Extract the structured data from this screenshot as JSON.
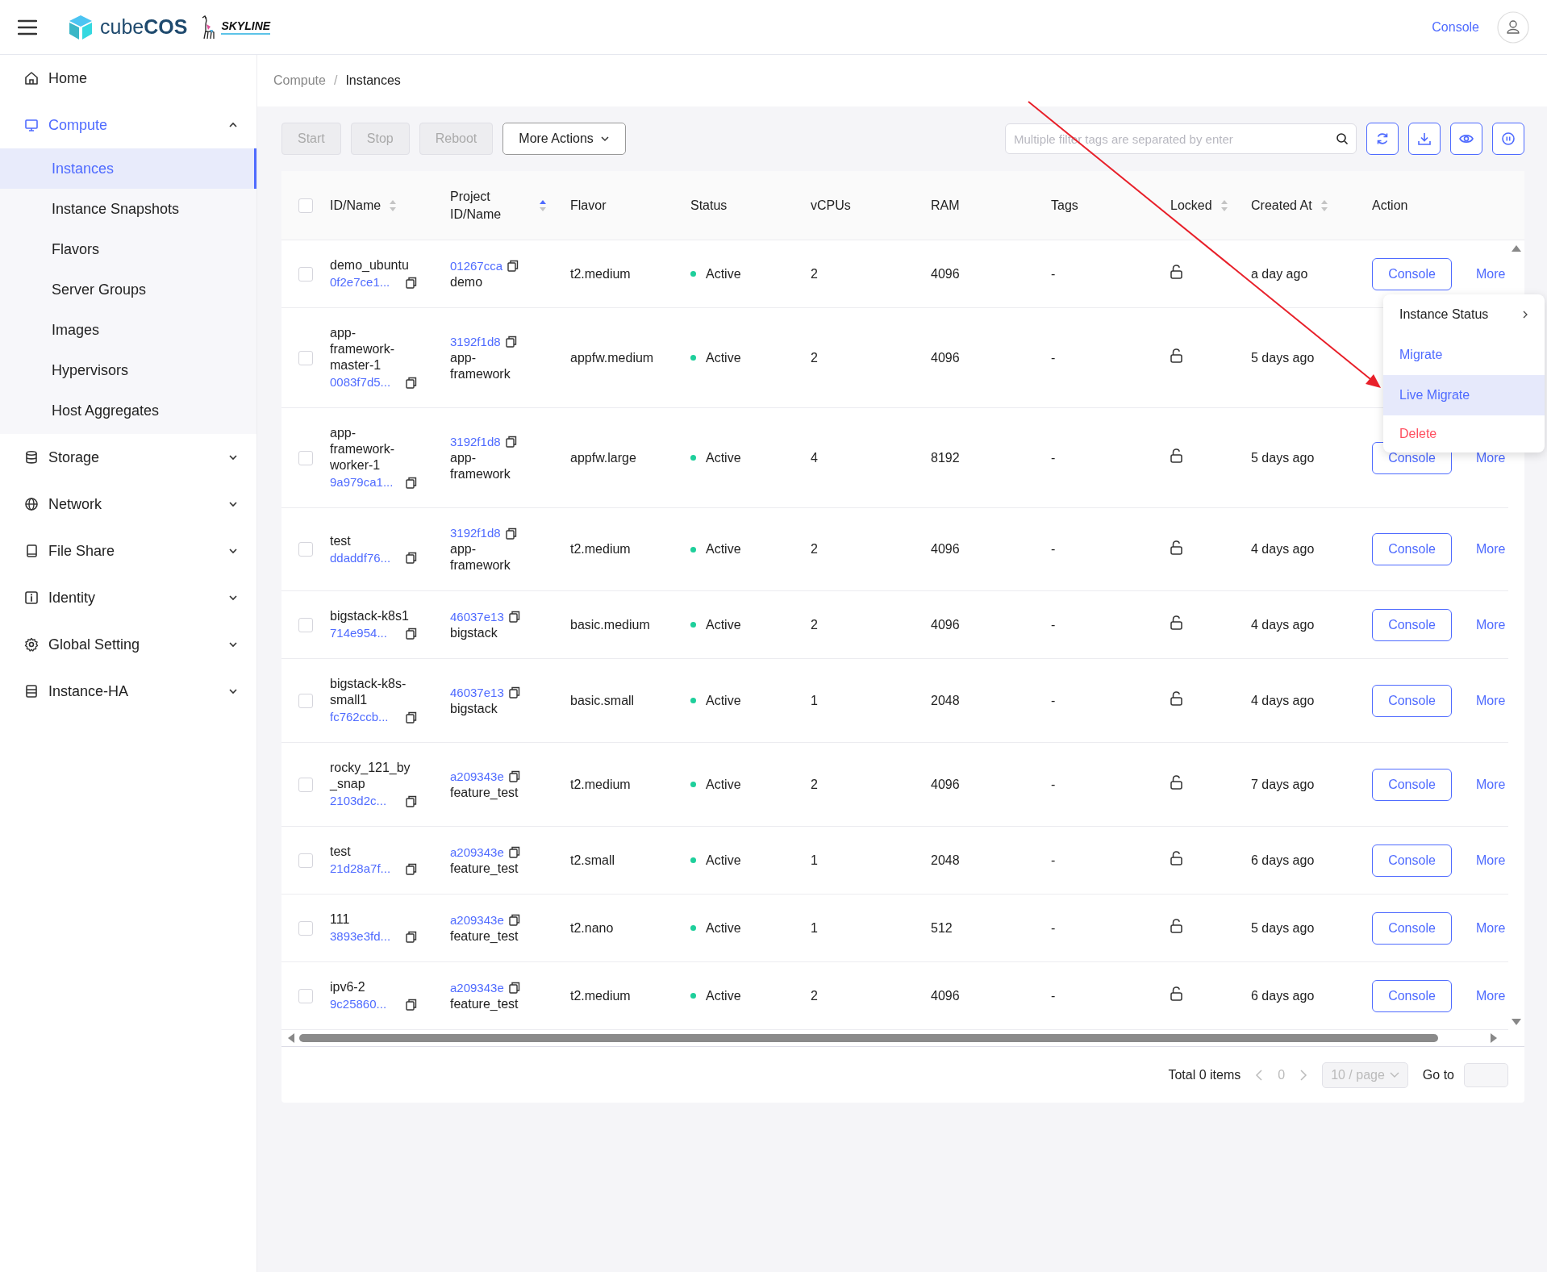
{
  "header": {
    "brand": "cube**COS**",
    "partner": "SKYLINE",
    "console_link": "Console"
  },
  "sidebar": {
    "items": [
      {
        "label": "Home"
      },
      {
        "label": "Compute",
        "expanded": true,
        "selected": true,
        "children": [
          {
            "label": "Instances",
            "selected": true
          },
          {
            "label": "Instance Snapshots",
            "selected": false
          },
          {
            "label": "Flavors",
            "selected": false
          },
          {
            "label": "Server Groups",
            "selected": false
          },
          {
            "label": "Images",
            "selected": false
          },
          {
            "label": "Hypervisors",
            "selected": false
          },
          {
            "label": "Host Aggregates",
            "selected": false
          }
        ]
      },
      {
        "label": "Storage",
        "expanded": false,
        "selected": false
      },
      {
        "label": "Network",
        "expanded": false,
        "selected": false
      },
      {
        "label": "File Share",
        "expanded": false,
        "selected": false
      },
      {
        "label": "Identity",
        "expanded": false,
        "selected": false
      },
      {
        "label": "Global Setting",
        "expanded": false,
        "selected": false
      },
      {
        "label": "Instance-HA",
        "expanded": false,
        "selected": false
      }
    ]
  },
  "breadcrumb": {
    "items": [
      "Compute",
      "Instances"
    ],
    "separator": "/"
  },
  "toolbar": {
    "buttons": [
      {
        "label": "Start",
        "kind": "plain",
        "disabled": true
      },
      {
        "label": "Stop",
        "kind": "plain",
        "disabled": true
      },
      {
        "label": "Reboot",
        "kind": "plain",
        "disabled": true
      },
      {
        "label": "More Actions",
        "kind": "dropdown",
        "disabled": false
      }
    ],
    "search": {
      "placeholder": "Multiple filter tags are separated by enter"
    }
  },
  "table": {
    "select_all_checked": false,
    "columns": [
      {
        "label": "ID/Name",
        "sorted_ascending": false
      },
      {
        "label": "Project ID/Name",
        "sorted_ascending": true
      },
      {
        "label": "Flavor"
      },
      {
        "label": "Status"
      },
      {
        "label": "vCPUs"
      },
      {
        "label": "RAM"
      },
      {
        "label": "Tags"
      },
      {
        "label": "Locked",
        "sorted_ascending": false
      },
      {
        "label": "Created At",
        "sorted_ascending": false
      }
    ],
    "action_column": {
      "label": "Action"
    },
    "rows": [
      {
        "checked": false,
        "name": "demo_ubuntu",
        "id": "0f2e7ce1...",
        "project_id": "01267cca",
        "project_name": "demo",
        "flavor": "t2.medium",
        "status": "Active",
        "vcpus": "2",
        "ram": "4096",
        "tags": "-",
        "locked": false,
        "created": "a day ago",
        "actions": [
          "Console",
          "More"
        ]
      },
      {
        "checked": false,
        "name": "app-framework-master-1",
        "id": "0083f7d5...",
        "project_id": "3192f1d8",
        "project_name": "app-framework",
        "flavor": "appfw.medium",
        "status": "Active",
        "vcpus": "2",
        "ram": "4096",
        "tags": "-",
        "locked": false,
        "created": "5 days ago",
        "actions": []
      },
      {
        "checked": false,
        "name": "app-framework-worker-1",
        "id": "9a979ca1...",
        "project_id": "3192f1d8",
        "project_name": "app-framework",
        "flavor": "appfw.large",
        "status": "Active",
        "vcpus": "4",
        "ram": "8192",
        "tags": "-",
        "locked": false,
        "created": "5 days ago",
        "actions": [
          "Console",
          "More"
        ]
      },
      {
        "checked": false,
        "name": "test",
        "id": "ddaddf76...",
        "project_id": "3192f1d8",
        "project_name": "app-framework",
        "flavor": "t2.medium",
        "status": "Active",
        "vcpus": "2",
        "ram": "4096",
        "tags": "-",
        "locked": false,
        "created": "4 days ago",
        "actions": [
          "Console",
          "More"
        ]
      },
      {
        "checked": false,
        "name": "bigstack-k8s1",
        "id": "714e954...",
        "project_id": "46037e13",
        "project_name": "bigstack",
        "flavor": "basic.medium",
        "status": "Active",
        "vcpus": "2",
        "ram": "4096",
        "tags": "-",
        "locked": false,
        "created": "4 days ago",
        "actions": [
          "Console",
          "More"
        ]
      },
      {
        "checked": false,
        "name": "bigstack-k8s-small1",
        "id": "fc762ccb...",
        "project_id": "46037e13",
        "project_name": "bigstack",
        "flavor": "basic.small",
        "status": "Active",
        "vcpus": "1",
        "ram": "2048",
        "tags": "-",
        "locked": false,
        "created": "4 days ago",
        "actions": [
          "Console",
          "More"
        ]
      },
      {
        "checked": false,
        "name": "rocky_121_by_snap",
        "id": "2103d2c...",
        "project_id": "a209343e",
        "project_name": "feature_test",
        "flavor": "t2.medium",
        "status": "Active",
        "vcpus": "2",
        "ram": "4096",
        "tags": "-",
        "locked": false,
        "created": "7 days ago",
        "actions": [
          "Console",
          "More"
        ]
      },
      {
        "checked": false,
        "name": "test",
        "id": "21d28a7f...",
        "project_id": "a209343e",
        "project_name": "feature_test",
        "flavor": "t2.small",
        "status": "Active",
        "vcpus": "1",
        "ram": "2048",
        "tags": "-",
        "locked": false,
        "created": "6 days ago",
        "actions": [
          "Console",
          "More"
        ]
      },
      {
        "checked": false,
        "name": "111",
        "id": "3893e3fd...",
        "project_id": "a209343e",
        "project_name": "feature_test",
        "flavor": "t2.nano",
        "status": "Active",
        "vcpus": "1",
        "ram": "512",
        "tags": "-",
        "locked": false,
        "created": "5 days ago",
        "actions": [
          "Console",
          "More"
        ]
      },
      {
        "checked": false,
        "name": "ipv6-2",
        "id": "9c25860...",
        "project_id": "a209343e",
        "project_name": "feature_test",
        "flavor": "t2.medium",
        "status": "Active",
        "vcpus": "2",
        "ram": "4096",
        "tags": "-",
        "locked": false,
        "created": "6 days ago",
        "actions": [
          "Console",
          "More"
        ]
      }
    ]
  },
  "row_menu": {
    "items": [
      {
        "label": "Instance Status",
        "kind": "submenu",
        "selected": false
      },
      {
        "label": "Migrate",
        "kind": "action",
        "selected": false
      },
      {
        "label": "Live Migrate",
        "kind": "action",
        "selected": true
      },
      {
        "label": "Delete",
        "kind": "danger",
        "selected": false
      }
    ]
  },
  "pagination": {
    "total": "Total 0 items",
    "page": "0",
    "page_size": "10 / page",
    "goto_label": "Go to"
  }
}
